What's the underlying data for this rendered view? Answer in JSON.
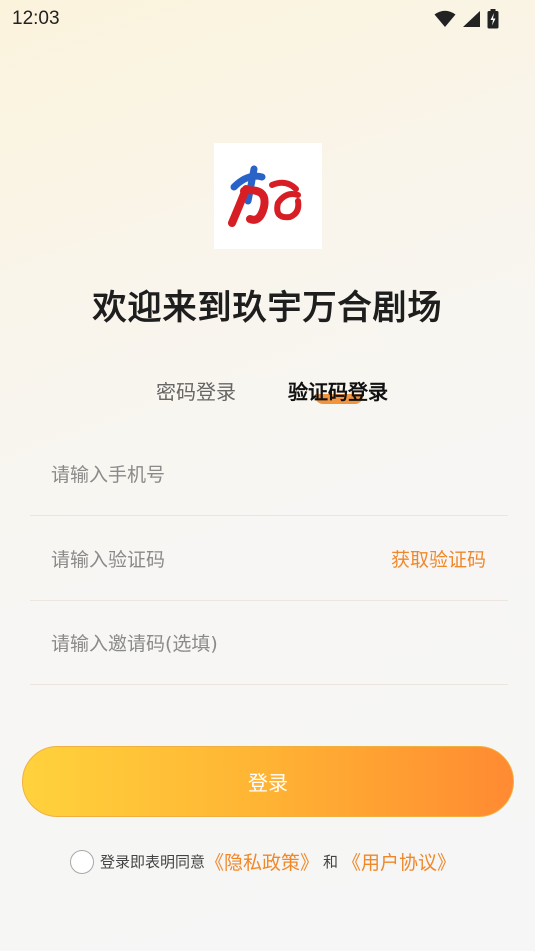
{
  "status_bar": {
    "time": "12:03",
    "icons": [
      "wifi-icon",
      "signal-icon",
      "battery-icon"
    ]
  },
  "header": {
    "logo": "brand-logo",
    "welcome_title": "欢迎来到玖宇万合剧场"
  },
  "tabs": [
    {
      "label": "密码登录",
      "active": false
    },
    {
      "label": "验证码登录",
      "active": true
    }
  ],
  "form": {
    "phone_placeholder": "请输入手机号",
    "code_placeholder": "请输入验证码",
    "get_code_label": "获取验证码",
    "invite_placeholder": "请输入邀请码(选填)"
  },
  "login_button_label": "登录",
  "agreement": {
    "checked": false,
    "prefix": "登录即表明同意",
    "privacy_link": "《隐私政策》",
    "and": "和",
    "user_link": "《用户协议》"
  },
  "colors": {
    "accent": "#f0882a",
    "button_start": "#ffd23c",
    "button_end": "#ff8a32",
    "logo_red": "#d81e25",
    "logo_blue": "#2a63c8"
  }
}
